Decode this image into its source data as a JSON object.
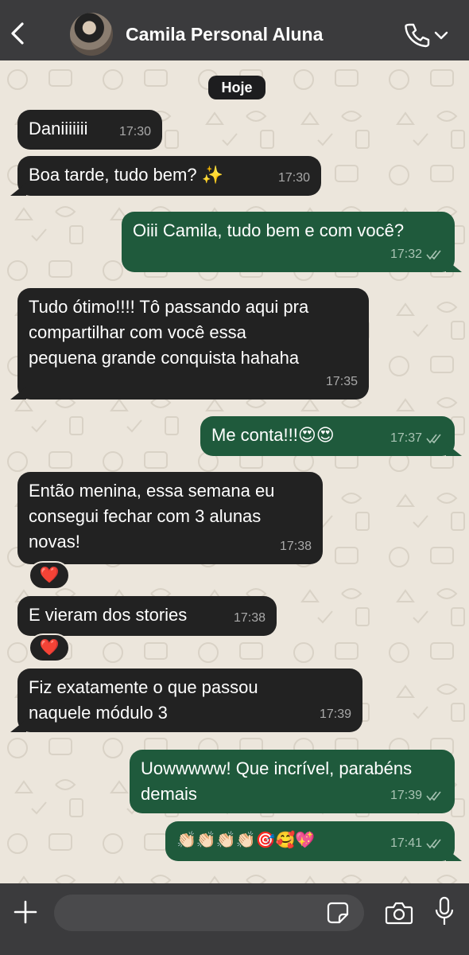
{
  "header": {
    "contact_name": "Camila Personal Aluna",
    "icons": {
      "back": "chevron-left-icon",
      "avatar": "contact-photo",
      "call": "phone-icon",
      "call_menu": "chevron-down-icon"
    }
  },
  "chat": {
    "date_label": "Hoje",
    "messages": [
      {
        "direction": "incoming",
        "lines": [
          "Daniiiiiii"
        ],
        "time": "17:30"
      },
      {
        "direction": "incoming",
        "lines": [
          "Boa tarde, tudo bem? ✨"
        ],
        "time": "17:30"
      },
      {
        "direction": "outgoing",
        "lines": [
          "Oiii Camila, tudo bem e com você?"
        ],
        "time": "17:32",
        "status": "read"
      },
      {
        "direction": "incoming",
        "lines": [
          "Tudo ótimo!!!! Tô passando aqui pra",
          "compartilhar com você essa",
          "pequena grande conquista hahaha"
        ],
        "time": "17:35"
      },
      {
        "direction": "outgoing",
        "lines": [
          "Me conta!!!😍😍"
        ],
        "time": "17:37",
        "status": "read"
      },
      {
        "direction": "incoming",
        "lines": [
          "Então menina, essa semana eu",
          "consegui fechar com 3 alunas",
          "novas!"
        ],
        "time": "17:38",
        "reaction": "❤️"
      },
      {
        "direction": "incoming",
        "lines": [
          "E vieram dos stories"
        ],
        "time": "17:38",
        "reaction": "❤️"
      },
      {
        "direction": "incoming",
        "lines": [
          "Fiz exatamente o que passou",
          "naquele módulo 3"
        ],
        "time": "17:39"
      },
      {
        "direction": "outgoing",
        "lines": [
          "Uowwwww! Que incrível, parabéns",
          "demais"
        ],
        "time": "17:39",
        "status": "read"
      },
      {
        "direction": "outgoing",
        "lines": [
          "👏🏻👏🏻👏🏻👏🏻🎯🥰💖"
        ],
        "time": "17:41",
        "status": "read"
      }
    ]
  },
  "composer": {
    "input_value": "",
    "icons": {
      "attach": "plus-icon",
      "sticker": "sticker-icon",
      "camera": "camera-icon",
      "mic": "microphone-icon"
    }
  },
  "colors": {
    "header_bg": "#3b3b3d",
    "incoming_bubble": "#222222",
    "outgoing_bubble": "#1f5a3c",
    "chat_bg": "#ece6dc",
    "tick_color": "#a8c3b3"
  }
}
